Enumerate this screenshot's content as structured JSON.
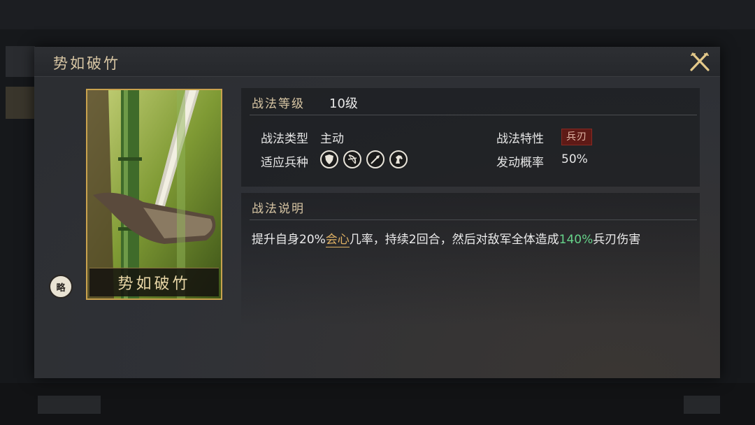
{
  "dialog": {
    "title": "势如破竹"
  },
  "card": {
    "name": "势如破竹",
    "badge": "略"
  },
  "info": {
    "level_label": "战法等级",
    "level_value": "10级",
    "type_label": "战法类型",
    "type_value": "主动",
    "trait_label": "战法特性",
    "trait_value": "兵刃",
    "troops_label": "适应兵种",
    "troops": [
      "shield-icon",
      "bow-icon",
      "spear-icon",
      "horse-icon"
    ],
    "rate_label": "发动概率",
    "rate_value": "50%"
  },
  "description": {
    "header": "战法说明",
    "part1": "提升自身20%",
    "highlight1": "会心",
    "part2": "几率，持续2回合，然后对敌军全体造成",
    "highlight2": "140%",
    "part3": "兵刃伤害"
  },
  "colors": {
    "gold": "#e0b264",
    "green": "#66d38a",
    "badge_red": "#5e1a16"
  }
}
